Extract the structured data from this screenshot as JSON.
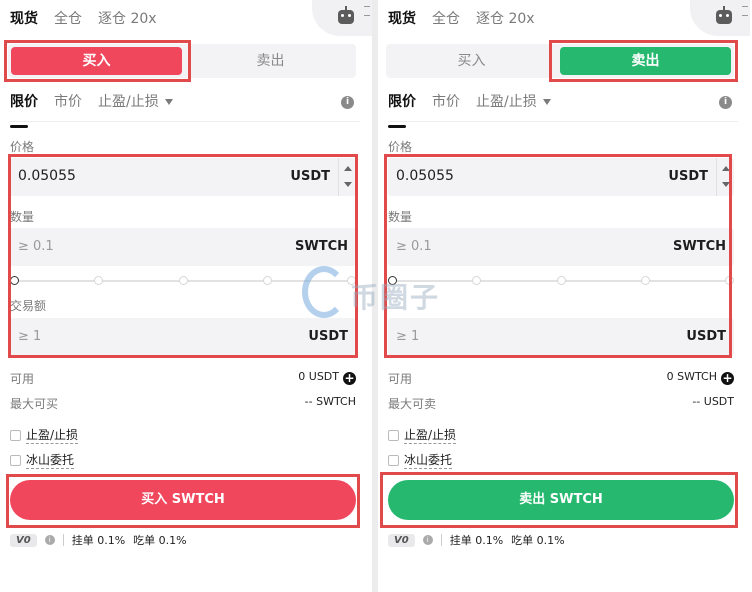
{
  "top_tabs": [
    "现货",
    "全仓",
    "逐仓 20x"
  ],
  "side": {
    "buy": "买入",
    "sell": "卖出"
  },
  "order_types": [
    "限价",
    "市价",
    "止盈/止损"
  ],
  "labels": {
    "price": "价格",
    "quantity": "数量",
    "amount": "交易额",
    "available": "可用",
    "max_buy": "最大可买",
    "max_sell": "最大可卖"
  },
  "buy_panel": {
    "price_value": "0.05055",
    "price_unit": "USDT",
    "qty_placeholder": "≥ 0.1",
    "qty_unit": "SWTCH",
    "amount_placeholder": "≥ 1",
    "amount_unit": "USDT",
    "available_value": "0 USDT",
    "max_value": "-- SWTCH",
    "submit": "买入 SWTCH"
  },
  "sell_panel": {
    "price_value": "0.05055",
    "price_unit": "USDT",
    "qty_placeholder": "≥ 0.1",
    "qty_unit": "SWTCH",
    "amount_placeholder": "≥ 1",
    "amount_unit": "USDT",
    "available_value": "0 SWTCH",
    "max_value": "-- USDT",
    "submit": "卖出 SWTCH"
  },
  "options": {
    "tp_sl": "止盈/止损",
    "iceberg": "冰山委托"
  },
  "fees": {
    "vip": "V0",
    "maker": "挂单 0.1%",
    "taker": "吃单 0.1%"
  },
  "watermark": {
    "text": "币圈子"
  },
  "colors": {
    "buy": "#f0475d",
    "sell": "#26b86f",
    "highlight": "#e04a4a"
  }
}
